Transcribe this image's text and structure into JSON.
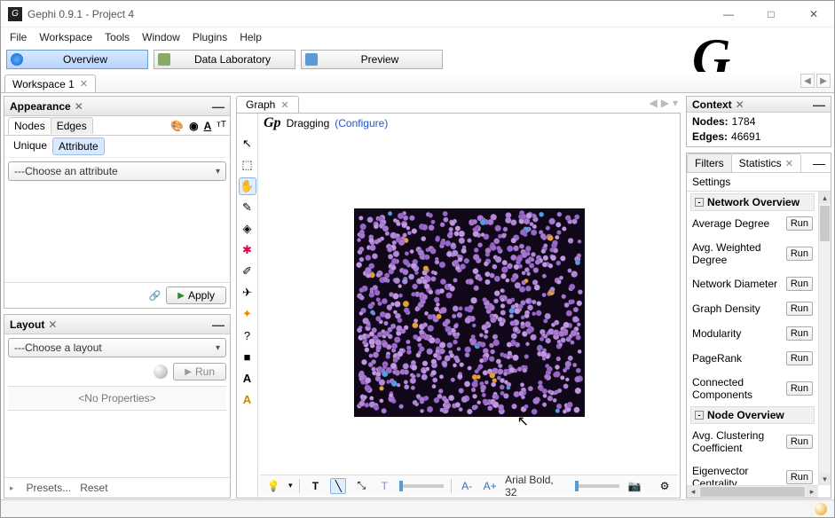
{
  "window": {
    "title": "Gephi 0.9.1 - Project 4"
  },
  "menu": [
    "File",
    "Workspace",
    "Tools",
    "Window",
    "Plugins",
    "Help"
  ],
  "maintabs": [
    {
      "label": "Overview",
      "active": true
    },
    {
      "label": "Data Laboratory",
      "active": false
    },
    {
      "label": "Preview",
      "active": false
    }
  ],
  "workspace": {
    "name": "Workspace 1"
  },
  "appearance": {
    "title": "Appearance",
    "tabs": {
      "nodes": "Nodes",
      "edges": "Edges"
    },
    "modes": {
      "unique": "Unique",
      "attribute": "Attribute"
    },
    "dropdown": "---Choose an attribute",
    "apply": "Apply"
  },
  "layout": {
    "title": "Layout",
    "dropdown": "---Choose a layout",
    "run": "Run",
    "noprops": "<No Properties>",
    "presets": "Presets...",
    "reset": "Reset"
  },
  "graph": {
    "title": "Graph",
    "mode": "Dragging",
    "configure": "(Configure)",
    "font": "Arial Bold, 32"
  },
  "context": {
    "title": "Context",
    "nodes_label": "Nodes:",
    "nodes_value": "1784",
    "edges_label": "Edges:",
    "edges_value": "46691"
  },
  "filters": {
    "filters": "Filters",
    "statistics": "Statistics",
    "settings": "Settings"
  },
  "stats": {
    "network_overview": "Network Overview",
    "node_overview": "Node Overview",
    "run": "Run",
    "items": [
      "Average Degree",
      "Avg. Weighted Degree",
      "Network Diameter",
      "Graph Density",
      "Modularity",
      "PageRank",
      "Connected Components"
    ],
    "node_items": [
      "Avg. Clustering Coefficient",
      "Eigenvector Centrality"
    ]
  },
  "bottom_toolbar": {
    "font_decrease": "A-",
    "font_increase": "A+"
  }
}
